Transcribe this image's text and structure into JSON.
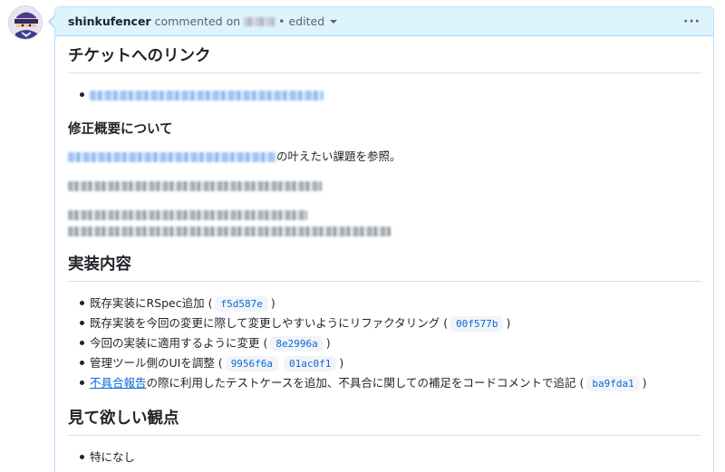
{
  "comment": {
    "author": "shinkufencer",
    "action_text": "commented on",
    "edited_label": "• edited",
    "more_label": "···"
  },
  "section_ticket": {
    "heading": "チケットへのリンク"
  },
  "section_summary": {
    "heading": "修正概要について",
    "ref_suffix": "の叶えたい課題を参照。"
  },
  "section_impl": {
    "heading": "実装内容",
    "items": [
      {
        "text": "既存実装にRSpec追加 (",
        "commits": [
          "f5d587e"
        ],
        "suffix": ")"
      },
      {
        "text": "既存実装を今回の変更に際して変更しやすいようにリファクタリング (",
        "commits": [
          "00f577b"
        ],
        "suffix": ")"
      },
      {
        "text": "今回の実装に適用するように変更 (",
        "commits": [
          "8e2996a"
        ],
        "suffix": ")"
      },
      {
        "text": "管理ツール側のUIを調整 (",
        "commits": [
          "9956f6a",
          "01ac0f1"
        ],
        "suffix": ")"
      },
      {
        "link": "不具合報告",
        "text": "の際に利用したテストケースを追加、不具合に関しての補足をコードコメントで追記 (",
        "commits": [
          "ba9fda1"
        ],
        "suffix": ")"
      }
    ]
  },
  "section_review": {
    "heading": "見て欲しい観点",
    "items": [
      "特になし"
    ]
  },
  "colors": {
    "header_bg": "#ddf4ff",
    "link": "#0969da",
    "text": "#1f2328"
  }
}
